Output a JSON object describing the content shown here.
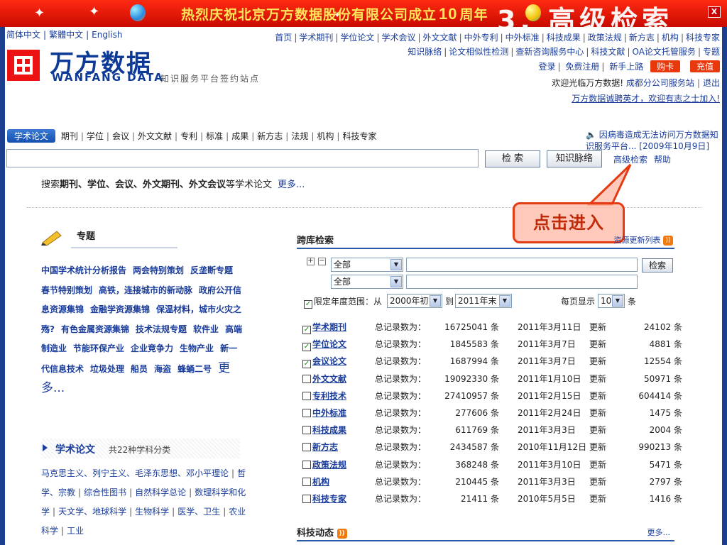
{
  "banner": {
    "text_pre": "热烈庆祝北京万方数据股份有限公司成立",
    "text_num": "10",
    "text_post": "周年",
    "overlay": "3. 高级检索",
    "close": "X"
  },
  "lang": [
    "简体中文",
    "繁體中文",
    "English"
  ],
  "toplinks": {
    "row1": [
      "首页",
      "学术期刊",
      "学位论文",
      "学术会议",
      "外文文献",
      "中外专利",
      "中外标准",
      "科技成果",
      "政策法规",
      "新方志",
      "机构",
      "科技专家"
    ],
    "row2": [
      "知识脉络",
      "论文相似性检测",
      "查新咨询服务中心",
      "科技文献",
      "OA论文托管服务",
      "专题"
    ],
    "row3": [
      "登录",
      "免费注册",
      "新手上路"
    ],
    "buy": "购卡",
    "recharge": "充值"
  },
  "logo": {
    "cn": "万方数据",
    "en": "WANFANG DATA",
    "sub": "知识服务平台签约站点"
  },
  "welcome": {
    "text": "欢迎光临万方数据!",
    "branch": "成都分公司服务站",
    "logout": "退出",
    "hire": "万方数据诚聘英才，欢迎有志之士加入!"
  },
  "nav": {
    "active": "学术论文",
    "items": [
      "期刊",
      "学位",
      "会议",
      "外文文献",
      "专利",
      "标准",
      "成果",
      "新方志",
      "法规",
      "机构",
      "科技专家"
    ]
  },
  "notice": "因病毒造成无法访问万方数据知识服务平台... [2009年10月9日]",
  "search": {
    "value": "",
    "btn_search": "检 索",
    "btn_knowledge": "知识脉络",
    "advanced": "高级检索",
    "help": "帮助"
  },
  "hint": {
    "pre": "搜索",
    "bold": "期刊、学位、会议、外文期刊、外文会议",
    "post": "等学术论文",
    "more": "更多..."
  },
  "callout": "点击进入",
  "topic": {
    "title": "专题",
    "items": [
      "中国学术统计分析报告",
      "两会特别策划",
      "反垄断专题",
      "春节特别策划",
      "高铁，连接城市的新动脉",
      "政府公开信息资源集锦",
      "金融学资源集锦",
      "保温材料，城市火灾之殇?",
      "有色金属资源集锦",
      "技术法规专题",
      "软件业",
      "高端制造业",
      "节能环保产业",
      "企业竞争力",
      "生物产业",
      "新一代信息技术",
      "垃圾处理",
      "船员",
      "海盗",
      "蜂蛹二号"
    ],
    "more": "更多..."
  },
  "xueshu": {
    "title": "学术论文",
    "count": "共22种学科分类",
    "subjects": [
      "马克思主义、列宁主义、毛泽东思想、邓小平理论",
      "哲学、宗教",
      "综合性图书",
      "自然科学总论",
      "数理科学和化学",
      "天文学、地球科学",
      "生物科学",
      "医学、卫生",
      "农业科学",
      "工业"
    ]
  },
  "cross": {
    "title": "跨库检索",
    "update_list": "资源更新列表",
    "select1": "全部",
    "select2": "全部",
    "search_btn": "检索",
    "year_label": "限定年度范围：从",
    "from": "2000年初",
    "to_label": "到",
    "to": "2011年末",
    "per_page_label": "每页显示",
    "per_page": "10",
    "per_page_unit": "条",
    "total_label": "总记录数为：",
    "unit": "条",
    "update": "更新",
    "rows": [
      {
        "name": "学术期刊",
        "checked": true,
        "total": "16725041",
        "date": "2011年3月11日",
        "count": "24102"
      },
      {
        "name": "学位论文",
        "checked": true,
        "total": "1845583",
        "date": "2011年3月7日",
        "count": "4881"
      },
      {
        "name": "会议论文",
        "checked": true,
        "total": "1687994",
        "date": "2011年3月7日",
        "count": "12554"
      },
      {
        "name": "外文文献",
        "checked": false,
        "total": "19092330",
        "date": "2011年1月10日",
        "count": "50971"
      },
      {
        "name": "专利技术",
        "checked": false,
        "total": "27410957",
        "date": "2011年2月15日",
        "count": "604414"
      },
      {
        "name": "中外标准",
        "checked": false,
        "total": "277606",
        "date": "2011年2月24日",
        "count": "1475"
      },
      {
        "name": "科技成果",
        "checked": false,
        "total": "611769",
        "date": "2011年3月3日",
        "count": "2004"
      },
      {
        "name": "新方志",
        "checked": false,
        "total": "2434587",
        "date": "2010年11月12日",
        "count": "990213"
      },
      {
        "name": "政策法规",
        "checked": false,
        "total": "368248",
        "date": "2011年3月10日",
        "count": "5471"
      },
      {
        "name": "机构",
        "checked": false,
        "total": "210445",
        "date": "2011年3月3日",
        "count": "2797"
      },
      {
        "name": "科技专家",
        "checked": false,
        "total": "21411",
        "date": "2010年5月5日",
        "count": "1416"
      }
    ]
  },
  "keji": {
    "title": "科技动态",
    "more": "更多..."
  },
  "colors": {
    "banner": "#d81405",
    "link": "#1a3d9c",
    "logo_red": "#e11111",
    "accent_orange": "#e8380c",
    "frame": "#1c3f8f"
  }
}
